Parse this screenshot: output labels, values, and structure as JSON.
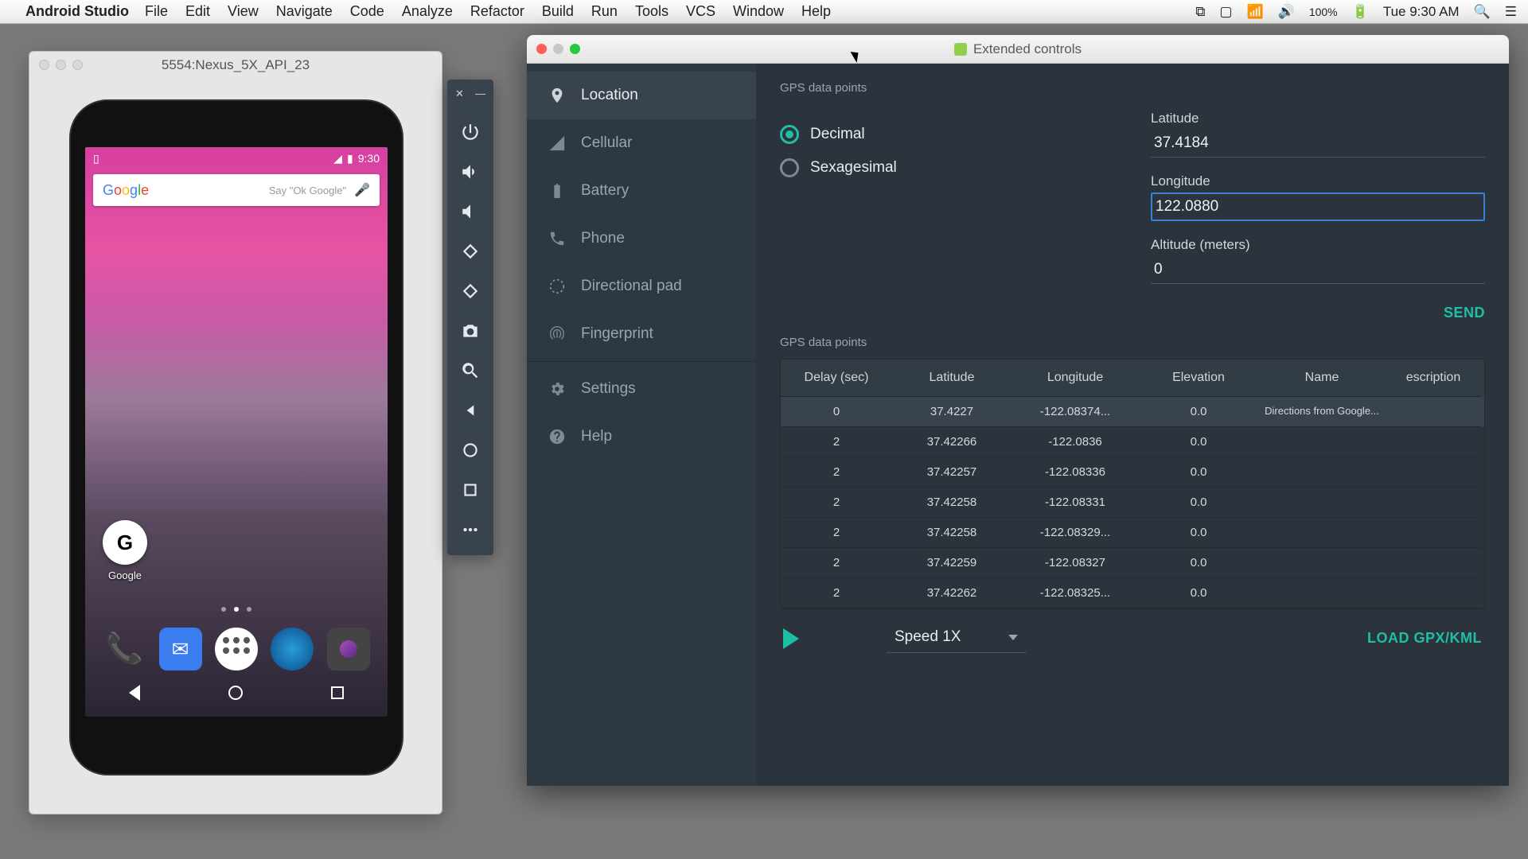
{
  "menubar": {
    "app": "Android Studio",
    "items": [
      "File",
      "Edit",
      "View",
      "Navigate",
      "Code",
      "Analyze",
      "Refactor",
      "Build",
      "Run",
      "Tools",
      "VCS",
      "Window",
      "Help"
    ],
    "battery": "100%",
    "clock": "Tue 9:30 AM"
  },
  "emulator": {
    "title": "5554:Nexus_5X_API_23",
    "status_time": "9:30",
    "search_placeholder": "Say \"Ok Google\"",
    "google_label": "Google"
  },
  "side_tools": [
    "close",
    "minimize",
    "power",
    "volume-up",
    "volume-down",
    "rotate-left",
    "rotate-right",
    "camera",
    "zoom",
    "back",
    "home",
    "overview",
    "more"
  ],
  "ext": {
    "title": "Extended controls",
    "menu": [
      {
        "icon": "location",
        "label": "Location",
        "active": true
      },
      {
        "icon": "cellular",
        "label": "Cellular"
      },
      {
        "icon": "battery",
        "label": "Battery"
      },
      {
        "icon": "phone",
        "label": "Phone"
      },
      {
        "icon": "dpad",
        "label": "Directional pad"
      },
      {
        "icon": "fingerprint",
        "label": "Fingerprint"
      },
      {
        "icon": "settings",
        "label": "Settings"
      },
      {
        "icon": "help",
        "label": "Help"
      }
    ],
    "section1": "GPS data points",
    "radios": {
      "decimal": "Decimal",
      "sexagesimal": "Sexagesimal",
      "selected": "decimal"
    },
    "fields": {
      "lat_label": "Latitude",
      "lat_value": "37.4184",
      "lon_label": "Longitude",
      "lon_value": "122.0880",
      "alt_label": "Altitude (meters)",
      "alt_value": "0"
    },
    "send": "SEND",
    "section2": "GPS data points",
    "columns": [
      "Delay (sec)",
      "Latitude",
      "Longitude",
      "Elevation",
      "Name",
      "escription"
    ],
    "rows": [
      {
        "delay": "0",
        "lat": "37.4227",
        "lon": "-122.08374...",
        "elev": "0.0",
        "name": "Directions from Google...",
        "desc": ""
      },
      {
        "delay": "2",
        "lat": "37.42266",
        "lon": "-122.0836",
        "elev": "0.0",
        "name": "",
        "desc": ""
      },
      {
        "delay": "2",
        "lat": "37.42257",
        "lon": "-122.08336",
        "elev": "0.0",
        "name": "",
        "desc": ""
      },
      {
        "delay": "2",
        "lat": "37.42258",
        "lon": "-122.08331",
        "elev": "0.0",
        "name": "",
        "desc": ""
      },
      {
        "delay": "2",
        "lat": "37.42258",
        "lon": "-122.08329...",
        "elev": "0.0",
        "name": "",
        "desc": ""
      },
      {
        "delay": "2",
        "lat": "37.42259",
        "lon": "-122.08327",
        "elev": "0.0",
        "name": "",
        "desc": ""
      },
      {
        "delay": "2",
        "lat": "37.42262",
        "lon": "-122.08325...",
        "elev": "0.0",
        "name": "",
        "desc": ""
      }
    ],
    "speed": "Speed 1X",
    "load": "LOAD GPX/KML"
  }
}
